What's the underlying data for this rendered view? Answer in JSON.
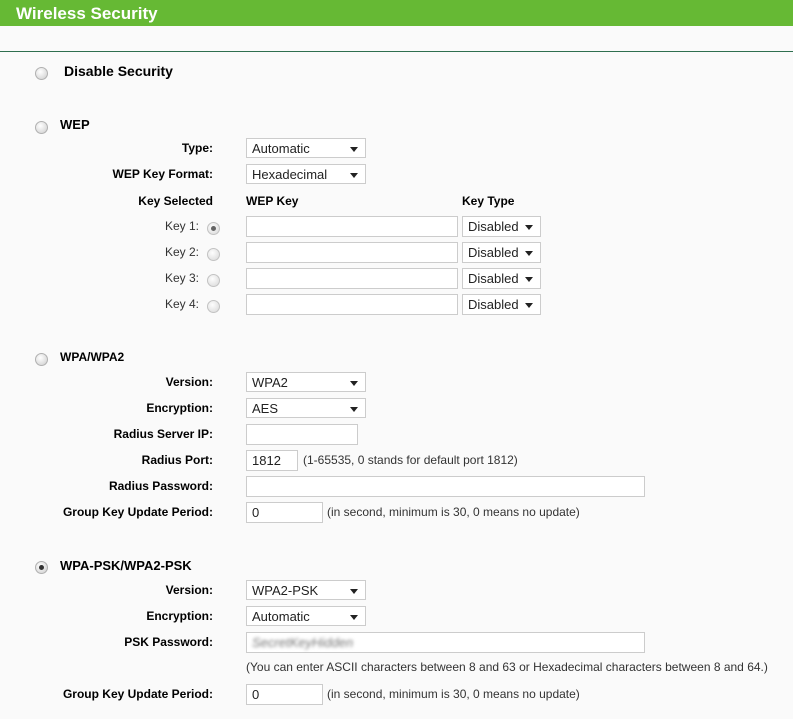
{
  "title": "Wireless Security",
  "disable": {
    "label": "Disable Security",
    "selected": false
  },
  "wep": {
    "label": "WEP",
    "selected": false,
    "type_label": "Type:",
    "type_value": "Automatic",
    "format_label": "WEP Key Format:",
    "format_value": "Hexadecimal",
    "col_key_selected": "Key Selected",
    "col_wep_key": "WEP Key",
    "col_key_type": "Key Type",
    "keys": [
      {
        "label": "Key 1:",
        "value": "",
        "type": "Disabled",
        "selected": true
      },
      {
        "label": "Key 2:",
        "value": "",
        "type": "Disabled",
        "selected": false
      },
      {
        "label": "Key 3:",
        "value": "",
        "type": "Disabled",
        "selected": false
      },
      {
        "label": "Key 4:",
        "value": "",
        "type": "Disabled",
        "selected": false
      }
    ]
  },
  "wpa": {
    "label": "WPA/WPA2",
    "selected": false,
    "version_label": "Version:",
    "version_value": "WPA2",
    "encryption_label": "Encryption:",
    "encryption_value": "AES",
    "radius_ip_label": "Radius Server IP:",
    "radius_ip_value": "",
    "radius_port_label": "Radius Port:",
    "radius_port_value": "1812",
    "radius_port_note": "(1-65535, 0 stands for default port 1812)",
    "radius_password_label": "Radius Password:",
    "radius_password_value": "",
    "group_key_label": "Group Key Update Period:",
    "group_key_value": "0",
    "group_key_note": "(in second, minimum is 30, 0 means no update)"
  },
  "psk": {
    "label": "WPA-PSK/WPA2-PSK",
    "selected": true,
    "version_label": "Version:",
    "version_value": "WPA2-PSK",
    "encryption_label": "Encryption:",
    "encryption_value": "Automatic",
    "password_label": "PSK Password:",
    "password_value": "SecretKeyHidden",
    "password_note": "(You can enter ASCII characters between 8 and 63 or Hexadecimal characters between 8 and 64.)",
    "group_key_label": "Group Key Update Period:",
    "group_key_value": "0",
    "group_key_note": "(in second, minimum is 30, 0 means no update)"
  }
}
